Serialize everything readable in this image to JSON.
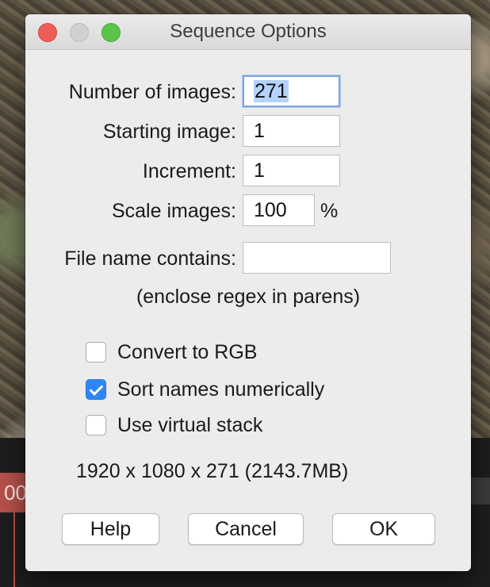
{
  "window": {
    "title": "Sequence Options"
  },
  "form": {
    "num_images_label": "Number of images:",
    "num_images_value": "271",
    "starting_label": "Starting image:",
    "starting_value": "1",
    "increment_label": "Increment:",
    "increment_value": "1",
    "scale_label": "Scale images:",
    "scale_value": "100",
    "scale_unit": "%",
    "filename_label": "File name contains:",
    "filename_value": "",
    "regex_hint": "(enclose regex in parens)"
  },
  "options": [
    {
      "label": "Convert to RGB",
      "checked": false
    },
    {
      "label": "Sort names numerically",
      "checked": true
    },
    {
      "label": "Use virtual stack",
      "checked": false
    }
  ],
  "info": "1920 x 1080 x 271 (2143.7MB)",
  "buttons": {
    "help": "Help",
    "cancel": "Cancel",
    "ok": "OK"
  },
  "background": {
    "tag_text": "00"
  },
  "colors": {
    "accent": "#2d86f5",
    "close": "#ec5f57",
    "maximize": "#5bc54a",
    "selection": "#b3d3fc"
  }
}
